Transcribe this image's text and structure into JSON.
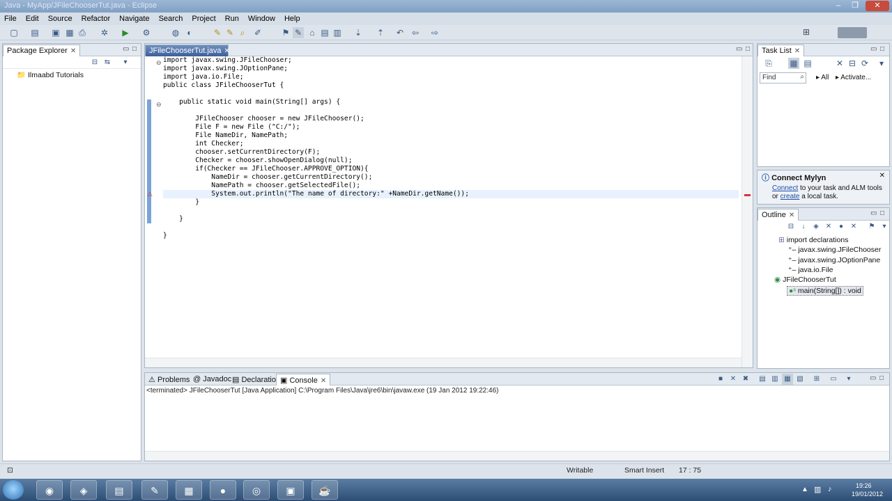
{
  "window": {
    "title": "Java - MyApp/JFileChooserTut.java - Eclipse"
  },
  "menu": [
    "File",
    "Edit",
    "Source",
    "Refactor",
    "Navigate",
    "Search",
    "Project",
    "Run",
    "Window",
    "Help"
  ],
  "package_explorer": {
    "tab_label": "Package Explorer",
    "project": "Ilmaabd Tutorials"
  },
  "editor": {
    "tab_label": "JFileChooserTut.java",
    "lines": [
      "import javax.swing.JFileChooser;",
      "import javax.swing.JOptionPane;",
      "import java.io.File;",
      "public class JFileChooserTut {",
      "",
      "    public static void main(String[] args) {",
      "",
      "        JFileChooser chooser = new JFileChooser();",
      "        File F = new File (\"C:/\");",
      "        File NameDir, NamePath;",
      "        int Checker;",
      "        chooser.setCurrentDirectory(F);",
      "        Checker = chooser.showOpenDialog(null);",
      "        if(Checker == JFileChooser.APPROVE_OPTION){",
      "            NameDir = chooser.getCurrentDirectory();",
      "            NamePath = chooser.getSelectedFile();",
      "            System.out.println(\"The name of directory:\" +NameDir.getName());",
      "        }",
      "",
      "    }",
      "",
      "}"
    ]
  },
  "task_list": {
    "tab_label": "Task List",
    "find_placeholder": "Find",
    "all_label": "All",
    "activate_label": "Activate..."
  },
  "mylyn": {
    "title": "Connect Mylyn",
    "line1_link": "Connect",
    "line1_rest": " to your task and ALM tools",
    "line2_pre": "or ",
    "line2_link": "create",
    "line2_rest": " a local task."
  },
  "outline": {
    "tab_label": "Outline",
    "imports_label": "import declarations",
    "imports": [
      "javax.swing.JFileChooser",
      "javax.swing.JOptionPane",
      "java.io.File"
    ],
    "class_name": "JFileChooserTut",
    "method": "main(String[]) : void"
  },
  "bottom_tabs": [
    "Problems",
    "Javadoc",
    "Declaration",
    "Console"
  ],
  "console": {
    "status": "<terminated> JFileChooserTut [Java Application] C:\\Program Files\\Java\\jre6\\bin\\javaw.exe (19 Jan 2012 19:22:46)"
  },
  "statusbar": {
    "writable": "Writable",
    "insert_mode": "Smart Insert",
    "position": "17 : 75"
  },
  "clock": {
    "time": "19:26",
    "date": "19/01/2012"
  },
  "colors": {
    "accent": "#3d5f99",
    "change_bar": "#7aa3d8",
    "string": "#2a00ff"
  }
}
